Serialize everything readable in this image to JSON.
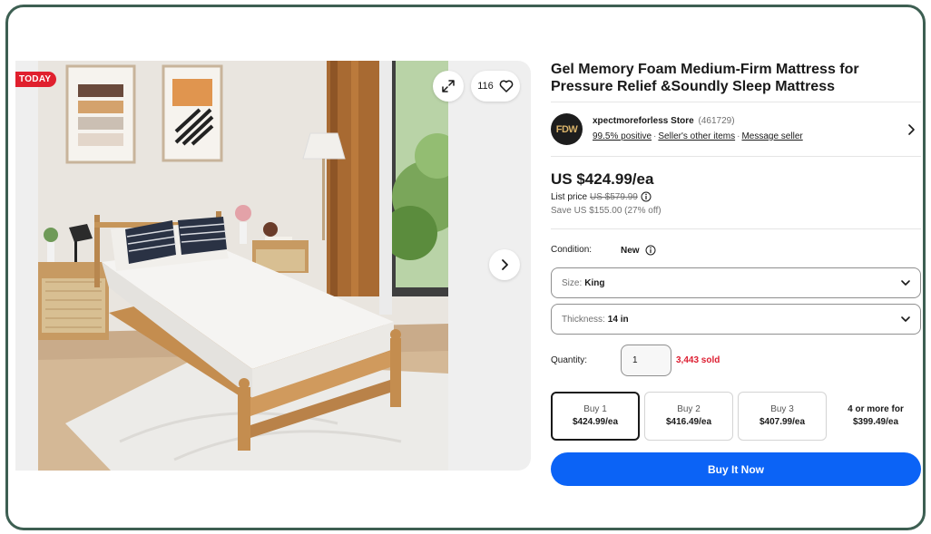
{
  "gallery": {
    "badge": "TODAY",
    "watchers_count": "116",
    "icons": {
      "expand": "expand-icon",
      "watch": "heart-icon",
      "next": "chevron-right-icon"
    }
  },
  "listing": {
    "title": "Gel Memory Foam Medium-Firm Mattress for Pressure Relief &Soundly Sleep Mattress"
  },
  "seller": {
    "logo_text": "FDW",
    "name": "xpectmoreforless Store",
    "feedback": "(461729)",
    "positive": "99.5% positive",
    "other_items": "Seller's other items",
    "message": "Message seller"
  },
  "pricing": {
    "price": "US $424.99/ea",
    "list_label": "List price",
    "list_value": "US $579.99",
    "save": "Save US $155.00 (27% off)"
  },
  "condition": {
    "label": "Condition:",
    "value": "New"
  },
  "options": {
    "size": {
      "label": "Size:",
      "value": "King"
    },
    "thickness": {
      "label": "Thickness:",
      "value": "14 in"
    }
  },
  "quantity": {
    "label": "Quantity:",
    "value": "1",
    "sold": "3,443 sold"
  },
  "tiers": [
    {
      "line1": "Buy 1",
      "line2": "$424.99/ea"
    },
    {
      "line1": "Buy 2",
      "line2": "$416.49/ea"
    },
    {
      "line1": "Buy 3",
      "line2": "$407.99/ea"
    },
    {
      "line1": "4 or more for",
      "line2": "$399.49/ea"
    }
  ],
  "buy_now": "Buy It Now",
  "colors": {
    "frame": "#3d5f52",
    "accent": "#0b63f6",
    "sold": "#dd1e31",
    "badge": "#e0202e"
  }
}
